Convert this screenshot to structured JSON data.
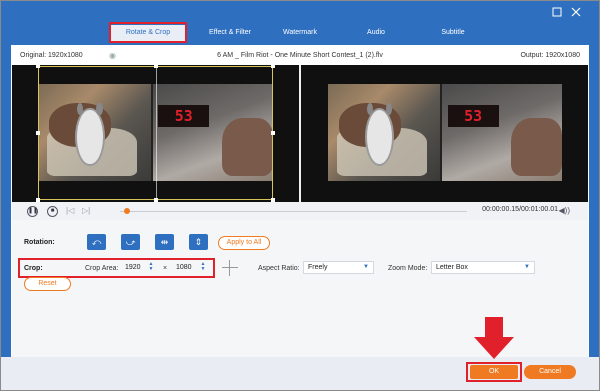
{
  "window": {
    "tabs": [
      {
        "label": "Rotate & Crop",
        "active": true
      },
      {
        "label": "Effect & Filter",
        "active": false
      },
      {
        "label": "Watermark",
        "active": false
      },
      {
        "label": "Audio",
        "active": false
      },
      {
        "label": "Subtitle",
        "active": false
      }
    ],
    "minimize_icon": "minimize-icon",
    "close_icon": "close-icon",
    "accent_color": "#2f6fc0",
    "highlight_color": "#e0202a",
    "button_color": "#f07a22"
  },
  "infobar": {
    "original": "Original: 1920x1080",
    "filename": "6 AM _ Film Riot - One Minute Short Contest_1 (2).flv",
    "output": "Output: 1920x1080"
  },
  "preview": {
    "clock_digits": "53"
  },
  "controls": {
    "time": "00:00:00.15/00:01:00.01",
    "progress": 0.02
  },
  "settings": {
    "rotation_label": "Rotation:",
    "apply_label": "Apply to All",
    "crop_label": "Crop:",
    "crop_area_label": "Crop Area:",
    "width": "1920",
    "times": "×",
    "height": "1080",
    "reset_label": "Reset",
    "aspect_label": "Aspect Ratio:",
    "aspect_value": "Freely",
    "zoom_label": "Zoom Mode:",
    "zoom_value": "Letter Box"
  },
  "footer": {
    "ok_label": "OK",
    "cancel_label": "Cancel"
  }
}
